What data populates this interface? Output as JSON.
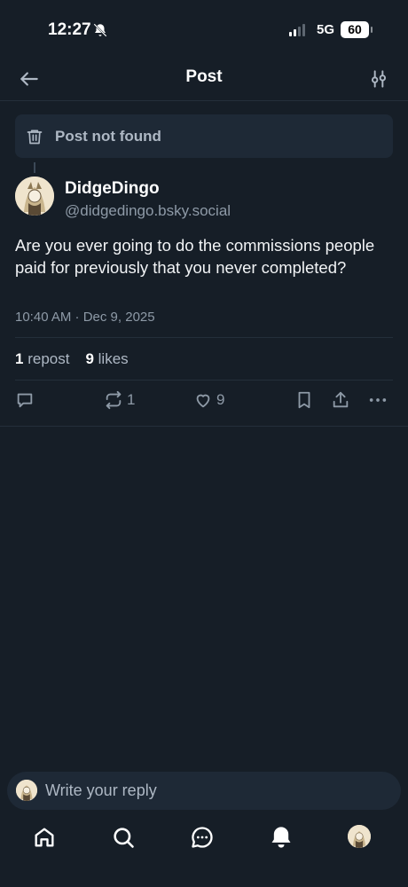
{
  "status_bar": {
    "time": "12:27",
    "network": "5G",
    "battery": "60"
  },
  "header": {
    "title": "Post"
  },
  "not_found": {
    "label": "Post not found"
  },
  "post": {
    "author_name": "DidgeDingo",
    "author_handle": "@didgedingo.bsky.social",
    "text": "Are you ever going to do the commissions people paid for previously that you never completed?",
    "timestamp": "10:40 AM · Dec 9, 2025",
    "repost_count": "1",
    "repost_label": "repost",
    "like_count": "9",
    "like_label": "likes",
    "actions": {
      "reply_count": "",
      "repost_count": "1",
      "like_count": "9"
    }
  },
  "reply_bar": {
    "placeholder": "Write your reply"
  },
  "colors": {
    "background": "#161e27",
    "card": "#1e2936",
    "muted_text": "#8e9aa7",
    "primary_text": "#f1f3f5"
  },
  "icons": {
    "back": "arrow-left-icon",
    "filter": "sliders-icon",
    "trash": "trash-icon",
    "reply": "speech-bubble-icon",
    "repost": "repost-icon",
    "like": "heart-icon",
    "bookmark": "bookmark-icon",
    "share": "share-icon",
    "more": "ellipsis-icon",
    "home": "home-icon",
    "search": "search-icon",
    "chat": "chat-icon",
    "notifications": "bell-icon"
  }
}
